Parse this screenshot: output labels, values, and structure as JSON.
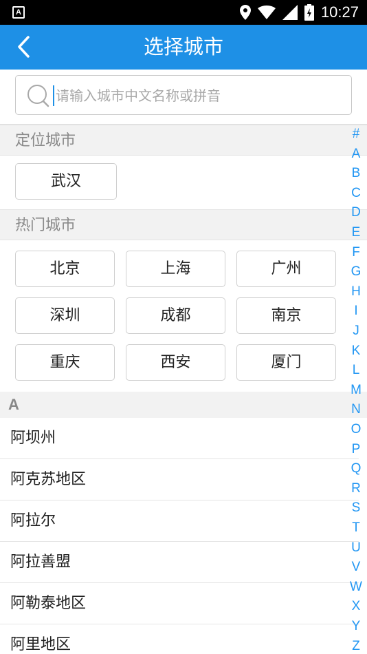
{
  "status_bar": {
    "notification_icon": "A",
    "time": "10:27"
  },
  "header": {
    "title": "选择城市",
    "back_icon": "chevron-left-icon"
  },
  "search": {
    "placeholder": "请输入城市中文名称或拼音",
    "value": ""
  },
  "located": {
    "label": "定位城市",
    "city": "武汉"
  },
  "hot": {
    "label": "热门城市",
    "cities": [
      "北京",
      "上海",
      "广州",
      "深圳",
      "成都",
      "南京",
      "重庆",
      "西安",
      "厦门"
    ]
  },
  "list": {
    "letter": "A",
    "cities": [
      "阿坝州",
      "阿克苏地区",
      "阿拉尔",
      "阿拉善盟",
      "阿勒泰地区",
      "阿里地区"
    ]
  },
  "index_letters": [
    "#",
    "A",
    "B",
    "C",
    "D",
    "E",
    "F",
    "G",
    "H",
    "I",
    "J",
    "K",
    "L",
    "M",
    "N",
    "O",
    "P",
    "Q",
    "R",
    "S",
    "T",
    "U",
    "V",
    "W",
    "X",
    "Y",
    "Z"
  ],
  "colors": {
    "primary": "#1e90e6",
    "index_letter": "#2196f3",
    "section_text": "#8a8a8a"
  }
}
